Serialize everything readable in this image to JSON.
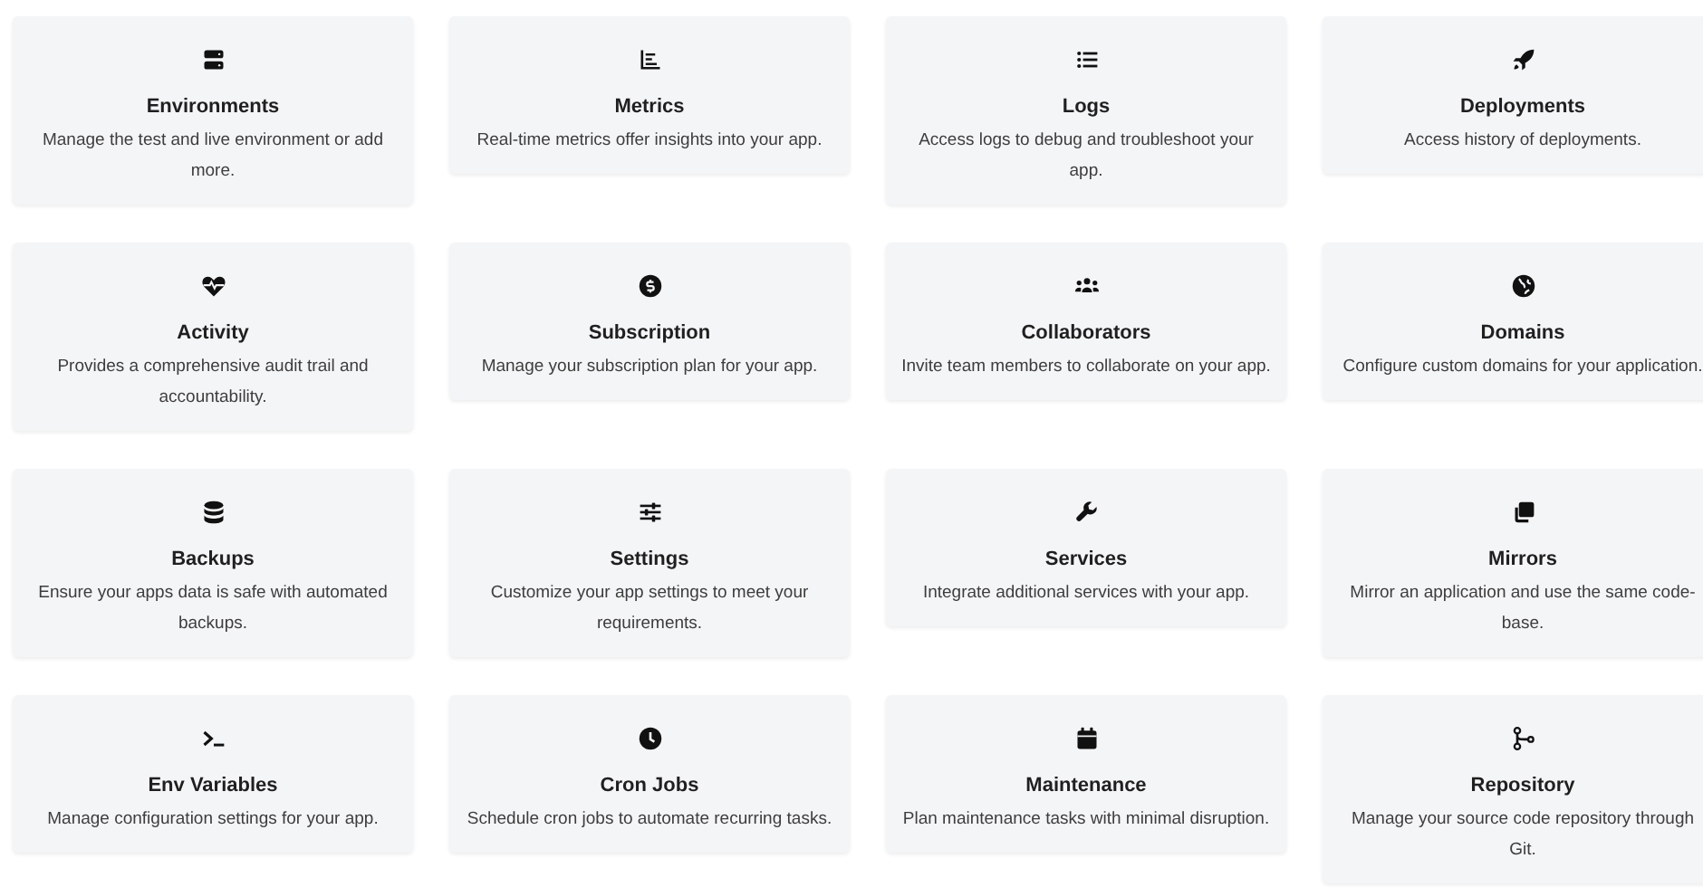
{
  "cards": [
    {
      "title": "Environments",
      "description": "Manage the test and live environment or add more."
    },
    {
      "title": "Metrics",
      "description": "Real-time metrics offer insights into your app."
    },
    {
      "title": "Logs",
      "description": "Access logs to debug and troubleshoot your app."
    },
    {
      "title": "Deployments",
      "description": "Access history of deployments."
    },
    {
      "title": "Activity",
      "description": "Provides a comprehensive audit trail and accountability."
    },
    {
      "title": "Subscription",
      "description": "Manage your subscription plan for your app."
    },
    {
      "title": "Collaborators",
      "description": "Invite team members to collaborate on your app."
    },
    {
      "title": "Domains",
      "description": "Configure custom domains for your application."
    },
    {
      "title": "Backups",
      "description": "Ensure your apps data is safe with automated backups."
    },
    {
      "title": "Settings",
      "description": "Customize your app settings to meet your requirements."
    },
    {
      "title": "Services",
      "description": "Integrate additional services with your app."
    },
    {
      "title": "Mirrors",
      "description": "Mirror an application and use the same code-base."
    },
    {
      "title": "Env Variables",
      "description": "Manage configuration settings for your app."
    },
    {
      "title": "Cron Jobs",
      "description": "Schedule cron jobs to automate recurring tasks."
    },
    {
      "title": "Maintenance",
      "description": "Plan maintenance tasks with minimal disruption."
    },
    {
      "title": "Repository",
      "description": "Manage your source code repository through Git."
    }
  ]
}
